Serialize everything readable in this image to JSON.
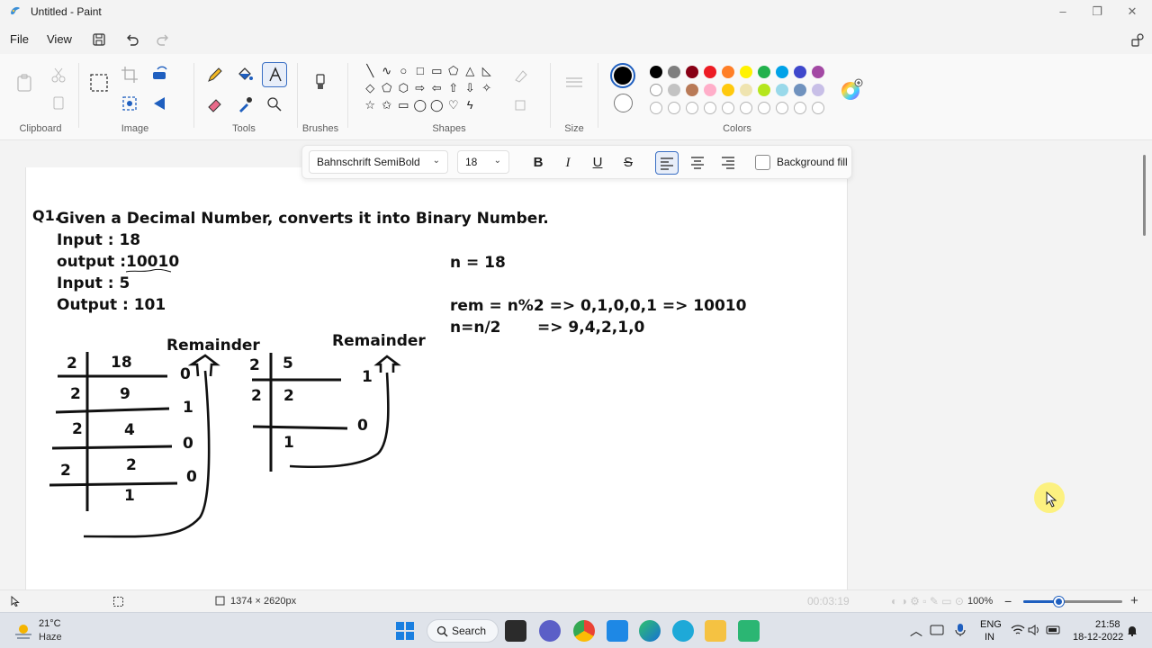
{
  "window": {
    "title": "Untitled - Paint",
    "minimize_icon": "minimize-icon",
    "maximize_icon": "maximize-icon",
    "close_icon": "close-icon"
  },
  "menu": {
    "file": "File",
    "view": "View"
  },
  "ribbon": {
    "groups": {
      "clipboard": "Clipboard",
      "image": "Image",
      "tools": "Tools",
      "brushes": "Brushes",
      "shapes": "Shapes",
      "size": "Size",
      "colors": "Colors"
    },
    "shape_glyphs": [
      "╲",
      "∿",
      "○",
      "□",
      "▭",
      "⬠",
      "△",
      "◺",
      "◇",
      "⬠",
      "⬡",
      "⇨",
      "⇦",
      "⇧",
      "⇩",
      "✧",
      "☆",
      "✩",
      "▭",
      "◯",
      "◯",
      "♡",
      "ϟ",
      ""
    ],
    "palette_row1": [
      "#000000",
      "#7f7f7f",
      "#880015",
      "#ed1c24",
      "#ff7f27",
      "#fff200",
      "#22b14c",
      "#00a2e8",
      "#3f48cc",
      "#a349a4"
    ],
    "palette_row2": [
      "#ffffff",
      "#c3c3c3",
      "#b97a57",
      "#ffaec9",
      "#ffc90e",
      "#efe4b0",
      "#b5e61d",
      "#99d9ea",
      "#7092be",
      "#c8bfe7"
    ],
    "primary_color": "#000000",
    "secondary_color": "#ffffff"
  },
  "text_toolbar": {
    "font": "Bahnschrift SemiBold",
    "size": "18",
    "bold": "B",
    "italic": "I",
    "underline": "U",
    "strike": "S",
    "background_fill": "Background fill"
  },
  "canvas_text": {
    "q_label": "Q1.",
    "question": "Given a Decimal Number, converts it into Binary Number.",
    "input1": "Input : 18",
    "output1_label": "output :",
    "output1_value": "10010",
    "input2": "Input : 5",
    "output2": "Output : 101",
    "remainder1": "Remainder",
    "remainder2": "Remainder",
    "n_eq": "n = 18",
    "rem_line": "rem = n%2 => 0,1,0,0,1 => 10010",
    "div_line": "n=n/2",
    "div_result": "=> 9,4,2,1,0",
    "div18": {
      "divisors": [
        "2",
        "2",
        "2",
        "2"
      ],
      "quotients": [
        "18",
        "9",
        "4",
        "2",
        "1"
      ],
      "remainders": [
        "0",
        "1",
        "0",
        "0"
      ]
    },
    "div5": {
      "divisors": [
        "2",
        "2"
      ],
      "quotients": [
        "5",
        "2",
        "1"
      ],
      "remainders": [
        "1",
        "0"
      ]
    }
  },
  "status": {
    "canvas_size": "1374 × 2620px",
    "timer": "00:03:19",
    "zoom": "100%",
    "zoom_level_percent": 35
  },
  "taskbar": {
    "temperature": "21°C",
    "weather": "Haze",
    "search": "Search",
    "language_top": "ENG",
    "language_bottom": "IN",
    "time": "21:58",
    "date": "18-12-2022"
  }
}
